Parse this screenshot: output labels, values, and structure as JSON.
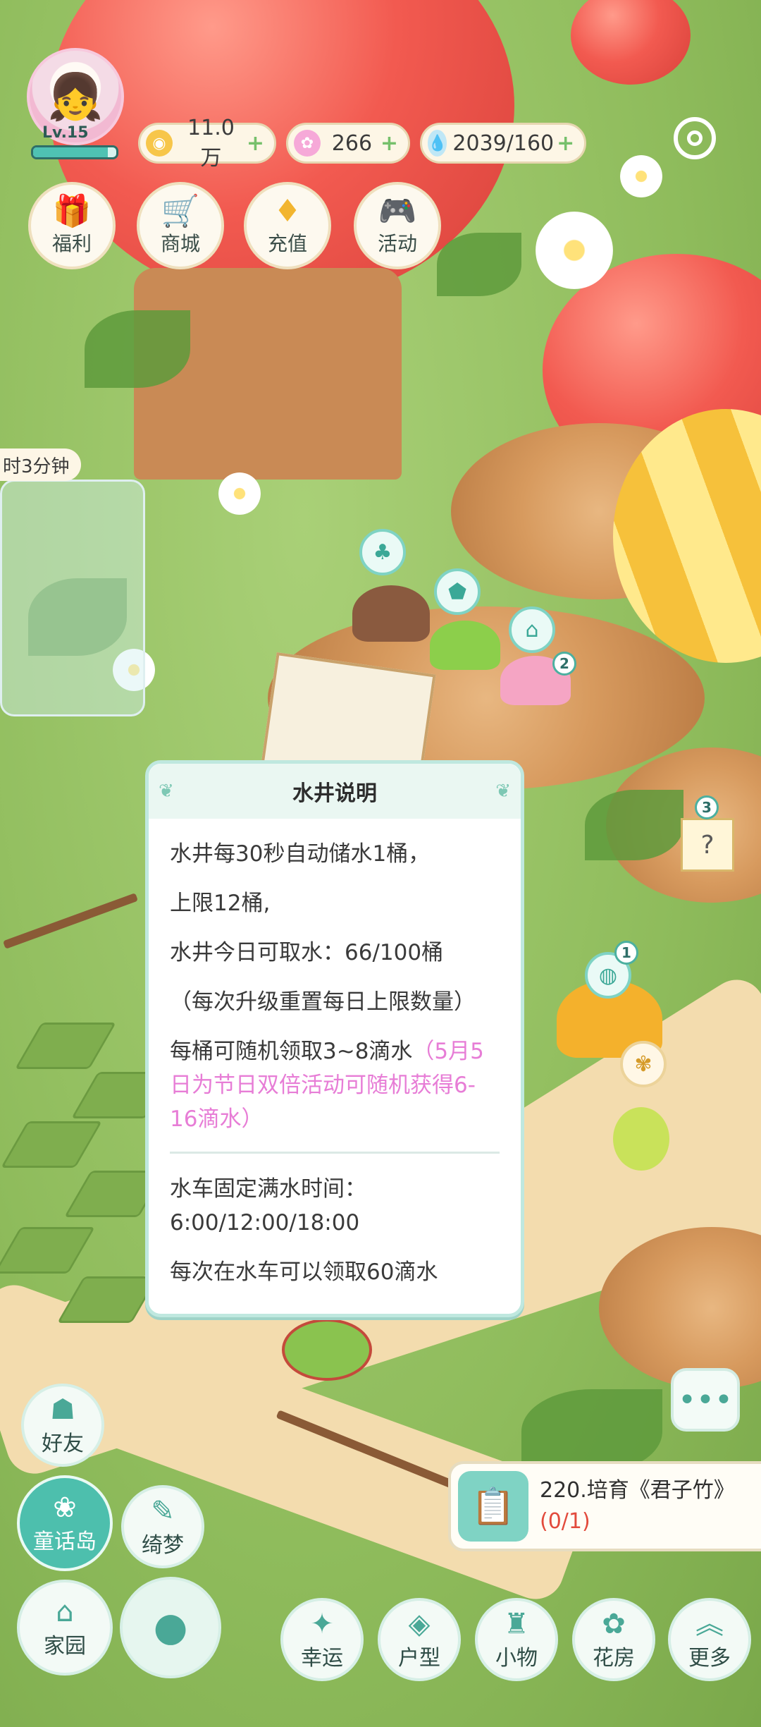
{
  "player": {
    "level": "Lv.15",
    "xp_fraction": 0.9
  },
  "resources": [
    {
      "name": "coins",
      "icon": "coin-icon",
      "value": "11.0万",
      "plus": "+"
    },
    {
      "name": "stars",
      "icon": "flower-star-icon",
      "value": "266",
      "plus": "+"
    },
    {
      "name": "water",
      "icon": "water-drop-icon",
      "value": "2039/160",
      "plus": "+"
    }
  ],
  "top_buttons": [
    {
      "label": "福利",
      "icon": "gift-icon"
    },
    {
      "label": "商城",
      "icon": "cart-icon"
    },
    {
      "label": "充值",
      "icon": "diamond-icon"
    },
    {
      "label": "活动",
      "icon": "gamepad-icon"
    }
  ],
  "timer_text": "时3分钟",
  "badges": {
    "box": "3",
    "water": "1",
    "sign": "2"
  },
  "dialog": {
    "title": "水井说明",
    "line1": "水井每30秒自动储水1桶，",
    "line2": "上限12桶,",
    "line3": "水井今日可取水：66/100桶",
    "line4": "（每次升级重置每日上限数量）",
    "line5_main": "每桶可随机领取3~8滴水",
    "line5_pink": "（5月5日为节日双倍活动可随机获得6-16滴水）",
    "line6": "水车固定满水时间：6:00/12:00/18:00",
    "line7": "每次在水车可以领取60滴水"
  },
  "task": {
    "title": "220.培育《君子竹》",
    "progress": "(0/1)"
  },
  "left_buttons": {
    "friends": "好友",
    "fairy_island": "童话岛",
    "dream": "绮梦",
    "home": "家园"
  },
  "bottom_nav": [
    {
      "label": "幸运",
      "icon": "lucky-icon"
    },
    {
      "label": "户型",
      "icon": "layout-icon"
    },
    {
      "label": "小物",
      "icon": "castle-icon"
    },
    {
      "label": "花房",
      "icon": "greenhouse-icon"
    },
    {
      "label": "更多",
      "icon": "chevron-up-icon"
    }
  ],
  "colors": {
    "accent": "#4dbfad",
    "pink_text": "#e77dd6",
    "task_progress": "#e24a3c"
  }
}
